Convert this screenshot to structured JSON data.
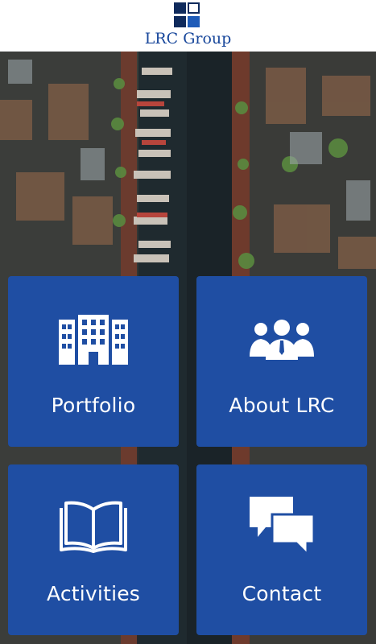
{
  "app": {
    "brand": "LRC Group"
  },
  "tiles": [
    {
      "label": "Portfolio",
      "icon": "building-icon"
    },
    {
      "label": "About LRC",
      "icon": "team-icon"
    },
    {
      "label": "Activities",
      "icon": "book-icon"
    },
    {
      "label": "Contact",
      "icon": "chat-icon"
    }
  ],
  "colors": {
    "tile": "#1f4ea3",
    "brand": "#18479b",
    "logo_dark": "#0f2a5c",
    "logo_accent": "#1e5bb8"
  }
}
